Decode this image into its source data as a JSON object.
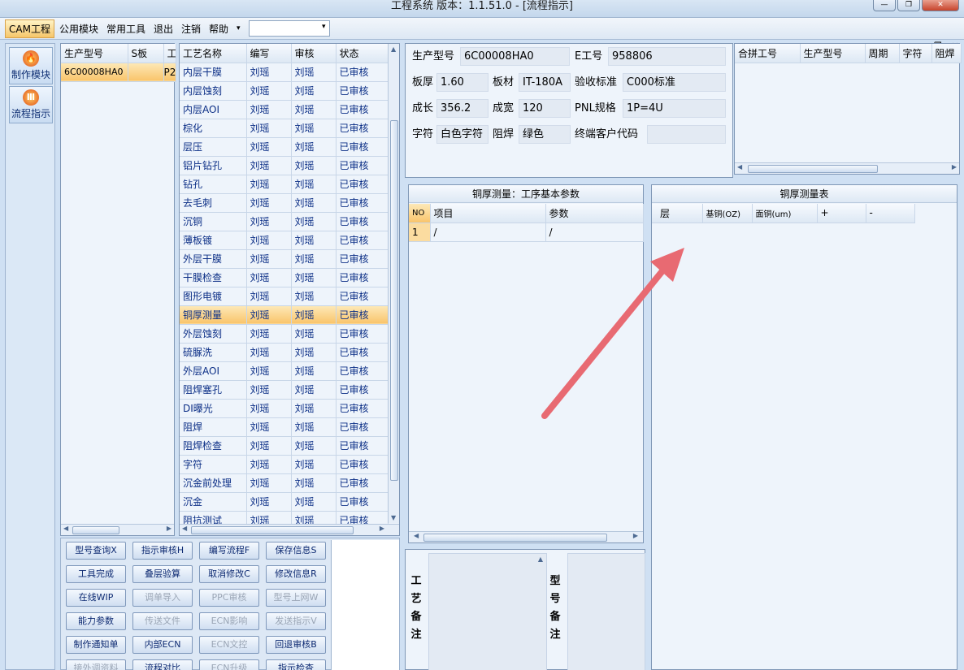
{
  "window": {
    "title": "工程系统  版本：1.1.51.0 - [流程指示]",
    "min": "—",
    "max": "❐",
    "close": "✕"
  },
  "menu": {
    "items": [
      "CAM工程",
      "公用模块",
      "常用工具",
      "退出",
      "注销",
      "帮助"
    ],
    "help_arrow": "▾",
    "mdi": [
      "_",
      "❐",
      "✕"
    ]
  },
  "nav": [
    {
      "label": "制作模块",
      "icon": "flame-icon",
      "glyph": "🔥"
    },
    {
      "label": "流程指示",
      "icon": "flow-icon",
      "glyph": "Ⅲ"
    }
  ],
  "models": {
    "headers": [
      "生产型号",
      "S板",
      "工"
    ],
    "rows": [
      [
        "6C00008HA0",
        "",
        "P2"
      ]
    ]
  },
  "process": {
    "headers": [
      "工艺名称",
      "编写",
      "审核",
      "状态"
    ],
    "rows": [
      [
        "内层干膜",
        "刘瑶",
        "刘瑶",
        "已审核"
      ],
      [
        "内层蚀刻",
        "刘瑶",
        "刘瑶",
        "已审核"
      ],
      [
        "内层AOI",
        "刘瑶",
        "刘瑶",
        "已审核"
      ],
      [
        "棕化",
        "刘瑶",
        "刘瑶",
        "已审核"
      ],
      [
        "层压",
        "刘瑶",
        "刘瑶",
        "已审核"
      ],
      [
        "铝片钻孔",
        "刘瑶",
        "刘瑶",
        "已审核"
      ],
      [
        "钻孔",
        "刘瑶",
        "刘瑶",
        "已审核"
      ],
      [
        "去毛刺",
        "刘瑶",
        "刘瑶",
        "已审核"
      ],
      [
        "沉铜",
        "刘瑶",
        "刘瑶",
        "已审核"
      ],
      [
        "薄板镀",
        "刘瑶",
        "刘瑶",
        "已审核"
      ],
      [
        "外层干膜",
        "刘瑶",
        "刘瑶",
        "已审核"
      ],
      [
        "干膜检查",
        "刘瑶",
        "刘瑶",
        "已审核"
      ],
      [
        "图形电镀",
        "刘瑶",
        "刘瑶",
        "已审核"
      ],
      [
        "铜厚测量",
        "刘瑶",
        "刘瑶",
        "已审核"
      ],
      [
        "外层蚀刻",
        "刘瑶",
        "刘瑶",
        "已审核"
      ],
      [
        "硫脲洗",
        "刘瑶",
        "刘瑶",
        "已审核"
      ],
      [
        "外层AOI",
        "刘瑶",
        "刘瑶",
        "已审核"
      ],
      [
        "阻焊塞孔",
        "刘瑶",
        "刘瑶",
        "已审核"
      ],
      [
        "DI曝光",
        "刘瑶",
        "刘瑶",
        "已审核"
      ],
      [
        "阻焊",
        "刘瑶",
        "刘瑶",
        "已审核"
      ],
      [
        "阻焊检查",
        "刘瑶",
        "刘瑶",
        "已审核"
      ],
      [
        "字符",
        "刘瑶",
        "刘瑶",
        "已审核"
      ],
      [
        "沉金前处理",
        "刘瑶",
        "刘瑶",
        "已审核"
      ],
      [
        "沉金",
        "刘瑶",
        "刘瑶",
        "已审核"
      ],
      [
        "阻抗测试",
        "刘瑶",
        "刘瑶",
        "已审核"
      ]
    ],
    "selected_index": 13
  },
  "buttons": [
    {
      "label": "型号查询X",
      "enabled": true
    },
    {
      "label": "指示审核H",
      "enabled": true
    },
    {
      "label": "编写流程F",
      "enabled": true
    },
    {
      "label": "保存信息S",
      "enabled": true
    },
    {
      "label": "工具完成",
      "enabled": true
    },
    {
      "label": "叠层验算",
      "enabled": true
    },
    {
      "label": "取消修改C",
      "enabled": true
    },
    {
      "label": "修改信息R",
      "enabled": true
    },
    {
      "label": "在线WIP",
      "enabled": true
    },
    {
      "label": "调单导入",
      "enabled": false
    },
    {
      "label": "PPC审核",
      "enabled": false
    },
    {
      "label": "型号上网W",
      "enabled": false
    },
    {
      "label": "能力参数",
      "enabled": true
    },
    {
      "label": "传送文件",
      "enabled": false
    },
    {
      "label": "ECN影响",
      "enabled": false
    },
    {
      "label": "发送指示V",
      "enabled": false
    },
    {
      "label": "制作通知单",
      "enabled": true
    },
    {
      "label": "内部ECN",
      "enabled": true
    },
    {
      "label": "ECN文控",
      "enabled": false
    },
    {
      "label": "回退审核B",
      "enabled": true
    },
    {
      "label": "接外调资料",
      "enabled": false
    },
    {
      "label": "流程对比",
      "enabled": true
    },
    {
      "label": "ECN升级",
      "enabled": false
    },
    {
      "label": "指示检查",
      "enabled": true
    }
  ],
  "info": {
    "model_label": "生产型号",
    "model_value": "6C00008HA0",
    "e_label": "E工号",
    "e_value": "958806",
    "thick_label": "板厚",
    "thick_value": "1.60",
    "mat_label": "板材",
    "mat_value": "IT-180A",
    "std_label": "验收标准",
    "std_value": "C000标准",
    "len_label": "成长",
    "len_value": "356.2",
    "wid_label": "成宽",
    "wid_value": "120",
    "pnl_label": "PNL规格",
    "pnl_value": "1P=4U",
    "char_label": "字符",
    "char_value": "白色字符",
    "mask_label": "阻焊",
    "mask_value": "绿色",
    "cust_label": "终端客户代码",
    "cust_value": ""
  },
  "merge": {
    "headers": [
      "合拼工号",
      "生产型号",
      "周期",
      "字符",
      "阻焊"
    ]
  },
  "params": {
    "title": "铜厚测量：工序基本参数",
    "headers": [
      "NO",
      "项目",
      "参数"
    ],
    "rows": [
      [
        "1",
        "/",
        "/"
      ]
    ]
  },
  "measure": {
    "title": "铜厚测量表",
    "headers": [
      "层",
      "基铜(OZ)",
      "面铜(um)",
      "+",
      "-"
    ]
  },
  "remarks": {
    "process": "工艺备注",
    "model": "型号备注"
  },
  "colors": {
    "accent": "#f9c46b",
    "annotation_arrow": "#e86a72"
  }
}
